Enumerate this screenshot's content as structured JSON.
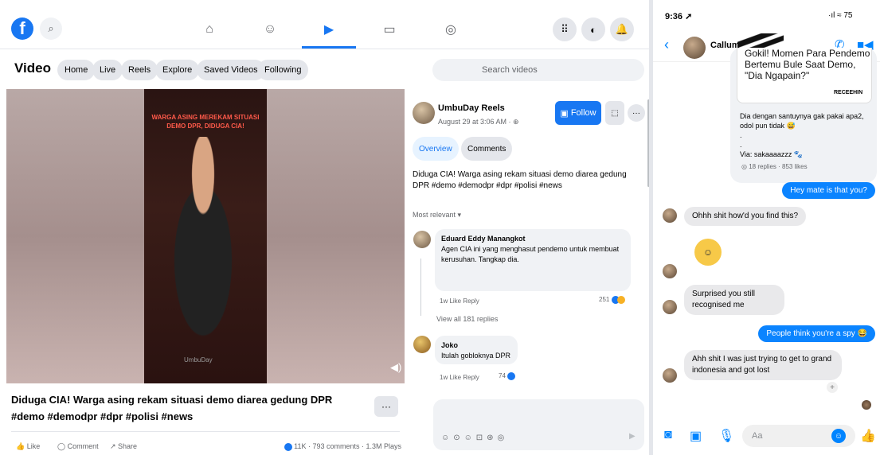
{
  "facebook": {
    "logo_letter": "f",
    "nav": {
      "home": "⌂",
      "friends": "☺",
      "video": "▶",
      "marketplace": "▭",
      "gaming": "◎"
    },
    "top_right_icons": [
      "menu-grid",
      "messenger",
      "notifications-bell"
    ],
    "video_section": {
      "title": "Video",
      "pills": [
        "Home",
        "Live",
        "Reels",
        "Explore",
        "Saved Videos",
        "Following"
      ],
      "search_placeholder": "Search videos"
    },
    "video": {
      "caption_overlay": "WARGA ASING MEREKAM SITUASI DEMO DPR, DIDUGA CIA!",
      "watermark": "UmbuDay"
    },
    "post": {
      "title": "Diduga CIA! Warga asing rekam situasi demo diarea gedung DPR #demo #demodpr #dpr #polisi #news",
      "more": "···",
      "actions": {
        "like": "Like",
        "comment": "Comment",
        "share": "Share"
      },
      "stats": "11K · 793 comments · 1.3M Plays"
    },
    "side": {
      "page_name": "UmbuDay Reels",
      "date": "August 29 at 3:06 AM · ⊕",
      "follow": "Follow",
      "tabs": [
        "Overview",
        "Comments"
      ],
      "description": "Diduga CIA! Warga asing rekam situasi demo diarea gedung DPR #demo #demodpr #dpr #polisi #news",
      "sort": "Most relevant ▾",
      "comments": [
        {
          "author": "Eduard Eddy Manangkot",
          "text": "Agen CIA ini yang menghasut pendemo untuk membuat kerusuhan. Tangkap dia.",
          "meta": "1w   Like   Reply",
          "reactions": "251"
        },
        {
          "author": "Joko",
          "text": "Itulah gobloknya DPR",
          "meta": "1w   Like   Reply",
          "reactions": "74"
        }
      ],
      "view_all": "View all 181 replies"
    }
  },
  "messenger": {
    "time": "9:36",
    "status": "·ıl ≈ 75",
    "contact": "Callum",
    "shared_post": {
      "headline": "Gokil! Momen Para Pendemo Bertemu Bule Saat Demo, \"Dia Ngapain?\"",
      "brand": "RECEEHIN",
      "caption": "Dia dengan santuynya gak pakai apa2, odol pun tidak 😅",
      "via": ".\n.\nVia: sakaaaazzz 🐾",
      "meta": "◎ 18 replies · 853 likes"
    },
    "messages": [
      {
        "dir": "out",
        "text": "Hey mate is that you?"
      },
      {
        "dir": "in",
        "text": "Ohhh shit how'd you find this?"
      },
      {
        "dir": "in",
        "text": "😬"
      },
      {
        "dir": "in",
        "text": "Surprised you still recognised me"
      },
      {
        "dir": "out",
        "text": "People think you're a spy 😂"
      },
      {
        "dir": "in",
        "text": "Ahh shit I was just trying to get to grand indonesia and got lost"
      }
    ],
    "input_placeholder": "Aa"
  }
}
